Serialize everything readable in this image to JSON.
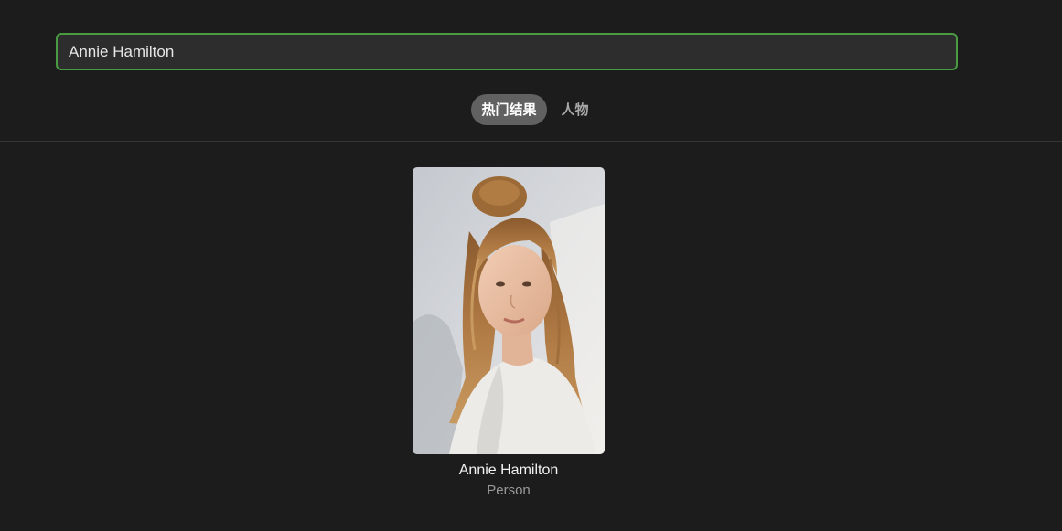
{
  "search": {
    "value": "Annie Hamilton",
    "accent_color": "#4a9a42"
  },
  "tabs": [
    {
      "label": "热门结果",
      "active": true
    },
    {
      "label": "人物",
      "active": false
    }
  ],
  "results": [
    {
      "name": "Annie Hamilton",
      "type": "Person"
    }
  ]
}
